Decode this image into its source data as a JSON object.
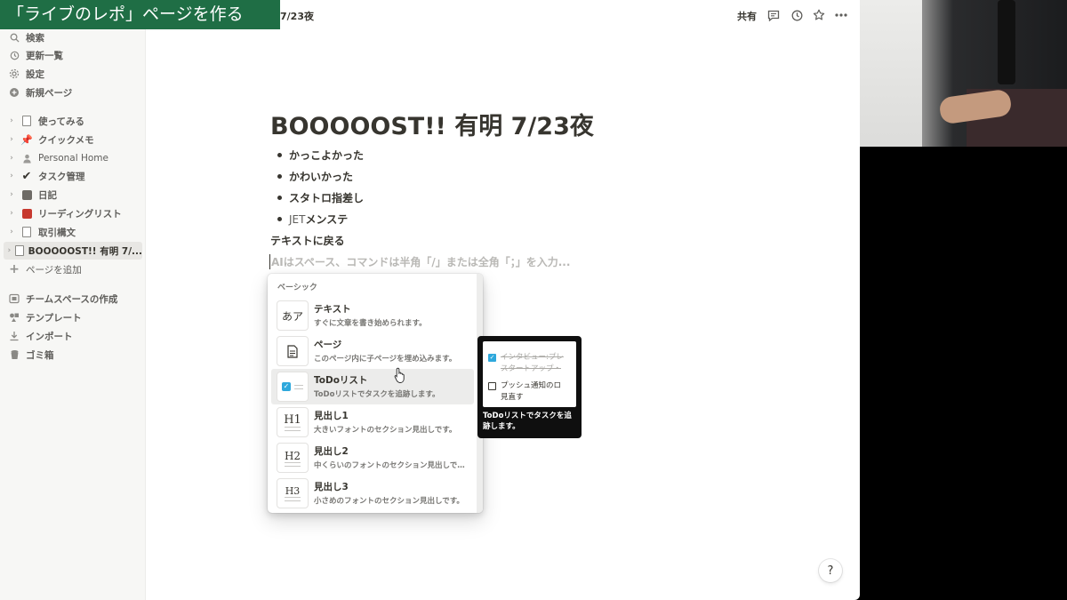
{
  "overlay": {
    "title": "「ライブのレポ」ページを作る"
  },
  "topbar": {
    "breadcrumb": "7/23夜",
    "share_label": "共有",
    "icons": [
      "comment-icon",
      "history-icon",
      "star-icon",
      "more-icon"
    ]
  },
  "sidebar": {
    "top_items": [
      {
        "icon": "search-icon",
        "label": "検索"
      },
      {
        "icon": "clock-icon",
        "label": "更新一覧"
      },
      {
        "icon": "gear-icon",
        "label": "設定"
      },
      {
        "icon": "plus-circle-icon",
        "label": "新規ページ"
      }
    ],
    "pages": [
      {
        "icon": "page-icon",
        "label": "使ってみる"
      },
      {
        "icon": "pin-icon",
        "label": "クイックメモ"
      },
      {
        "icon": "person-icon",
        "label": "Personal Home"
      },
      {
        "icon": "check-icon",
        "label": "タスク管理"
      },
      {
        "icon": "notebook-icon",
        "label": "日記"
      },
      {
        "icon": "book-icon",
        "label": "リーディングリスト"
      },
      {
        "icon": "page-icon",
        "label": "取引構文"
      },
      {
        "icon": "page-icon",
        "label": "BOOOOOST!! 有明 7/..."
      }
    ],
    "add_page_label": "ページを追加",
    "bottom_items": [
      {
        "icon": "teamspace-icon",
        "label": "チームスペースの作成"
      },
      {
        "icon": "template-icon",
        "label": "テンプレート"
      },
      {
        "icon": "import-icon",
        "label": "インポート"
      },
      {
        "icon": "trash-icon",
        "label": "ゴミ箱"
      }
    ]
  },
  "page": {
    "title": "BOOOOOST!! 有明 7/23夜",
    "bullets": [
      "かっこよかった",
      "かわいかった",
      "スタトロ指差し"
    ],
    "bullet_jet_prefix": "JET",
    "bullet_jet_rest": "メンステ",
    "back_text": "テキストに戻る",
    "command_placeholder": "AIはスペース、コマンドは半角「/」または全角「；」を入力..."
  },
  "slash_menu": {
    "heading": "ベーシック",
    "items": [
      {
        "thumb": "あア",
        "title": "テキスト",
        "desc": "すぐに文章を書き始められます。"
      },
      {
        "thumb": "page",
        "title": "ページ",
        "desc": "このページ内に子ページを埋め込みます。"
      },
      {
        "thumb": "todo",
        "title": "ToDoリスト",
        "desc": "ToDoリストでタスクを追跡します。"
      },
      {
        "thumb": "H1",
        "title": "見出し1",
        "desc": "大きいフォントのセクション見出しです。"
      },
      {
        "thumb": "H2",
        "title": "見出し2",
        "desc": "中くらいのフォントのセクション見出しです。"
      },
      {
        "thumb": "H3",
        "title": "見出し3",
        "desc": "小さめのフォントのセクション見出しです。"
      }
    ],
    "hovered_index": 2
  },
  "preview": {
    "row1": "インタビュー:プレ",
    "row1b": "スタートアップ・",
    "row2": "プッシュ通知のロ",
    "row2b": "見直す",
    "caption": "ToDoリストでタスクを追跡します。"
  },
  "help_label": "?",
  "colors": {
    "overlay_bg": "#1f6e45",
    "todo_blue": "#2ea8dc",
    "sidebar_bg": "#f7f7f5"
  }
}
